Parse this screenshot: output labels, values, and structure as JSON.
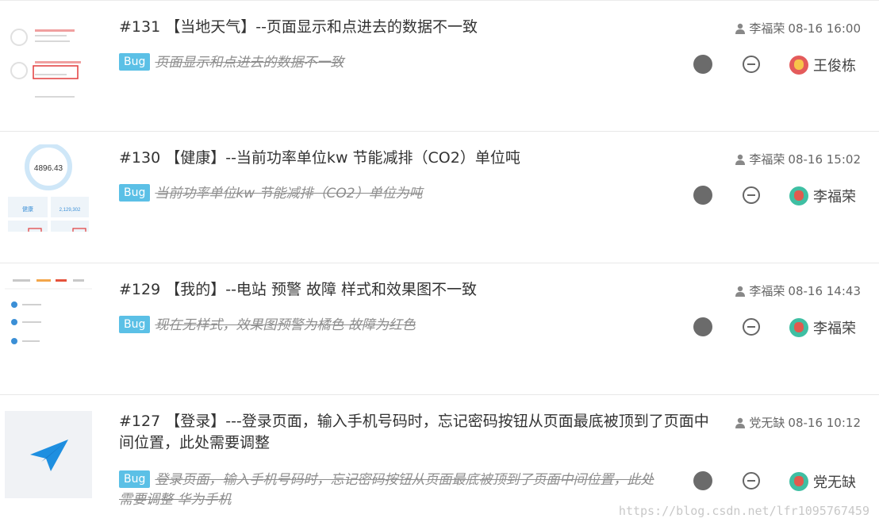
{
  "items": [
    {
      "number_title": "#131 【当地天气】--页面显示和点进去的数据不一致",
      "reporter": "李福荣",
      "time": "08-16 16:00",
      "badge": "Bug",
      "desc": "页面显示和点进去的数据不一致",
      "assignee": "王俊栋",
      "avatar_color": "red"
    },
    {
      "number_title": "#130 【健康】--当前功率单位kw 节能减排（CO2）单位吨",
      "reporter": "李福荣",
      "time": "08-16 15:02",
      "badge": "Bug",
      "desc": "当前功率单位kw 节能减排（CO2）单位为吨",
      "assignee": "李福荣",
      "avatar_color": "teal",
      "thumb_value": "4896.43",
      "thumb_label_1": "健康",
      "thumb_label_2": "2,129,302"
    },
    {
      "number_title": "#129 【我的】--电站 预警 故障 样式和效果图不一致",
      "reporter": "李福荣",
      "time": "08-16 14:43",
      "badge": "Bug",
      "desc": "现在无样式，效果图预警为橘色 故障为红色",
      "assignee": "李福荣",
      "avatar_color": "teal"
    },
    {
      "number_title": "#127 【登录】---登录页面，输入手机号码时，忘记密码按钮从页面最底被顶到了页面中间位置，此处需要调整",
      "reporter": "党无缺",
      "time": "08-16 10:12",
      "badge": "Bug",
      "desc": "登录页面，输入手机号码时，忘记密码按钮从页面最底被顶到了页面中间位置，此处需要调整 华为手机",
      "assignee": "党无缺",
      "avatar_color": "teal"
    }
  ],
  "watermark": "https://blog.csdn.net/lfr1095767459",
  "colors": {
    "badge": "#5bc0e6",
    "status_dot": "#6b6b6b",
    "plane": "#1e8fe0"
  }
}
